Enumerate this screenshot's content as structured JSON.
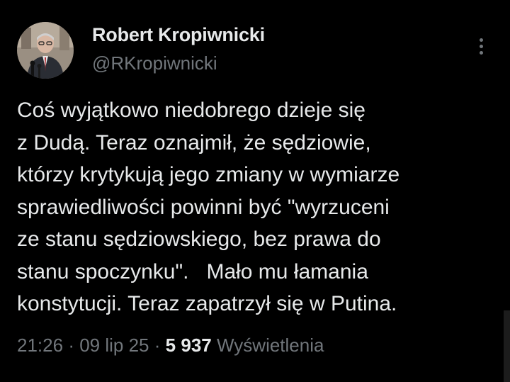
{
  "author": {
    "name": "Robert Kropiwnicki",
    "handle": "@RKropiwnicki",
    "avatar_icon": "profile-photo"
  },
  "more_icon": "more-vertical-icon",
  "tweet": {
    "lines": [
      "Coś wyjątkowo niedobrego dzieje się",
      "z Dudą. Teraz oznajmił, że sędziowie,",
      "którzy krytykują jego zmiany w wymiarze",
      "sprawiedliwości powinni być \"wyrzuceni",
      "ze stanu sędziowskiego, bez prawa do",
      "stanu spoczynku\".   Mało mu łamania",
      "konstytucji. Teraz zapatrzył się w Putina."
    ]
  },
  "meta": {
    "time": "21:26",
    "separator": "·",
    "date": "09 lip 25",
    "views_count": "5 937",
    "views_label": "Wyświetlenia"
  },
  "colors": {
    "background": "#000000",
    "primary_text": "#e7e9ea",
    "secondary_text": "#71767b"
  }
}
